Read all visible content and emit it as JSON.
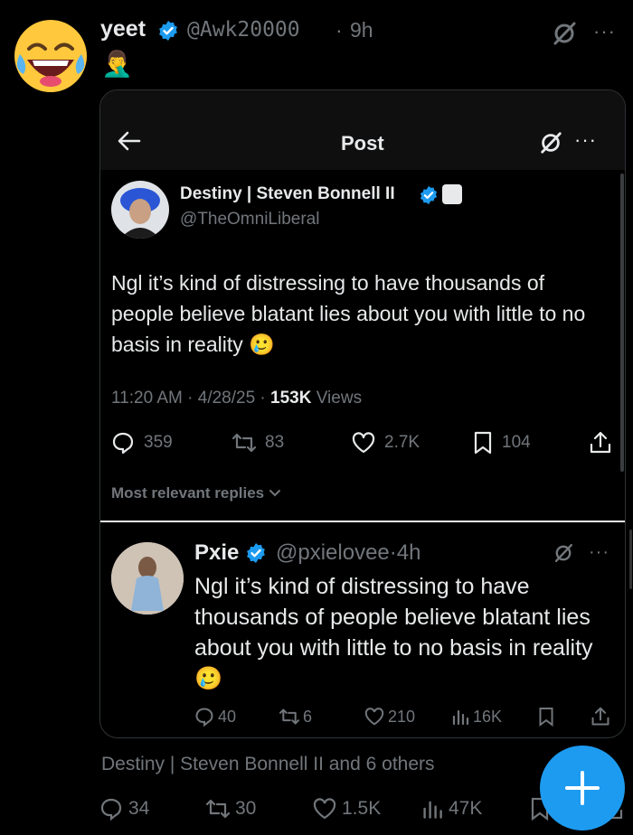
{
  "outer_post": {
    "display_name": "yeet",
    "handle": "@Awk20000",
    "separator": "·",
    "time": "9h",
    "emoji": "🤦‍♂️",
    "avatar_emoji": "😂"
  },
  "card": {
    "title": "Post",
    "more": "···",
    "original_post": {
      "display_name": "Destiny | Steven Bonnell II",
      "handle": "@TheOmniLiberal",
      "text": "Ngl it’s kind of distressing to have thousands of people believe blatant lies about you with little to no basis in reality 🥲",
      "time": "11:20 AM · 4/28/25 · ",
      "views_count": "153K",
      "views_label": " Views",
      "stats": {
        "replies": "359",
        "reposts": "83",
        "likes": "2.7K",
        "bookmarks": "104"
      }
    },
    "sort_label": "Most relevant replies",
    "reply": {
      "display_name": "Pxie",
      "handle": "@pxielovee",
      "separator": "·",
      "time": "4h",
      "text": "Ngl it’s kind of distressing to have thousands of people believe blatant lies about you with little to no basis in reality 🥲",
      "stats": {
        "replies": "40",
        "reposts": "6",
        "likes": "210",
        "views": "16K"
      }
    }
  },
  "footer": {
    "liked_by": "Destiny | Steven Bonnell II and 6 others",
    "stats": {
      "replies": "34",
      "reposts": "30",
      "likes": "1.5K",
      "views": "47K"
    }
  },
  "colors": {
    "accent": "#1d9bf0",
    "text": "#e7e9ea",
    "muted": "#71767b",
    "background": "#000000"
  }
}
